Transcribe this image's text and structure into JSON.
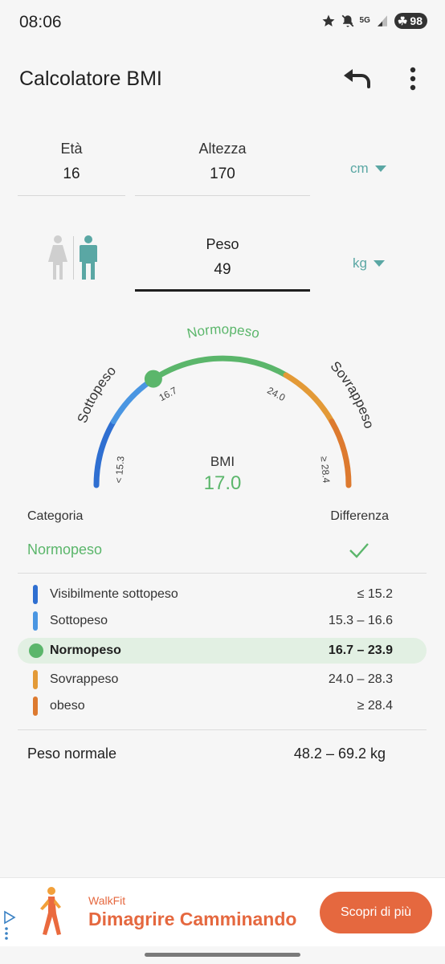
{
  "status_bar": {
    "time": "08:06",
    "network": "5G",
    "battery": "98"
  },
  "app_bar": {
    "title": "Calcolatore BMI"
  },
  "inputs": {
    "age": {
      "label": "Età",
      "value": "16"
    },
    "height": {
      "label": "Altezza",
      "value": "170",
      "unit": "cm"
    },
    "weight": {
      "label": "Peso",
      "value": "49",
      "unit": "kg"
    }
  },
  "gauge": {
    "bmi_label": "BMI",
    "bmi_value": "17.0",
    "bmi": 17.0,
    "segments": [
      {
        "label": "Sottopeso",
        "color": "#3f8ee0"
      },
      {
        "label": "Normopeso",
        "color": "#5bb66b"
      },
      {
        "label": "Sovrappeso",
        "color": "#e08a2e"
      }
    ],
    "tick_labels": [
      "< 15.3",
      "16.7",
      "24.0",
      "≥ 28.4"
    ]
  },
  "result": {
    "category_header": "Categoria",
    "difference_header": "Differenza",
    "current_category": "Normopeso"
  },
  "categories": [
    {
      "name": "Visibilmente sottopeso",
      "range": "≤ 15.2",
      "color": "#2f6fd1",
      "active": false
    },
    {
      "name": "Sottopeso",
      "range": "15.3 – 16.6",
      "color": "#4a96e2",
      "active": false
    },
    {
      "name": "Normopeso",
      "range": "16.7 – 23.9",
      "color": "#5bb66b",
      "active": true
    },
    {
      "name": "Sovrappeso",
      "range": "24.0 – 28.3",
      "color": "#e39a37",
      "active": false
    },
    {
      "name": "obeso",
      "range": "≥ 28.4",
      "color": "#dd7a2f",
      "active": false
    }
  ],
  "normal_weight": {
    "label": "Peso normale",
    "value": "48.2 – 69.2 kg"
  },
  "ad": {
    "brand": "WalkFit",
    "headline": "Dimagrire Camminando",
    "cta": "Scopri di più"
  },
  "colors": {
    "accent_teal": "#5aa7a4",
    "normal_green": "#5bb66b",
    "ad_orange": "#e5683f"
  }
}
